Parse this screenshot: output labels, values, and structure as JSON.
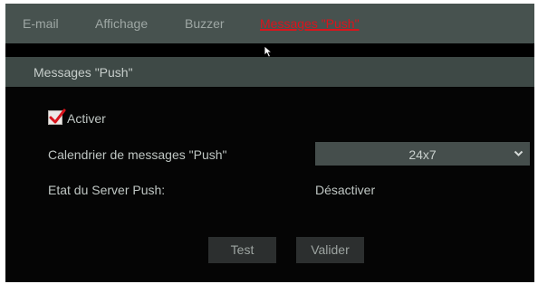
{
  "tabs": [
    {
      "label": "E-mail",
      "active": false
    },
    {
      "label": "Affichage",
      "active": false
    },
    {
      "label": "Buzzer",
      "active": false
    },
    {
      "label": "Messages \"Push\"",
      "active": true
    }
  ],
  "section": {
    "title": "Messages \"Push\""
  },
  "form": {
    "enable": {
      "label": "Activer",
      "checked": true
    },
    "schedule": {
      "label": "Calendrier de messages \"Push\"",
      "value": "24x7"
    },
    "server_status": {
      "label": "Etat du Server Push:",
      "value": "Désactiver"
    }
  },
  "buttons": {
    "test_label": "Test",
    "apply_label": "Valider"
  },
  "colors": {
    "active_tab": "#d9141c",
    "check_mark": "#d9141c"
  },
  "icons": {
    "cursor": "mouse-pointer-icon",
    "chevron": "chevron-down-icon",
    "check": "check-icon"
  }
}
